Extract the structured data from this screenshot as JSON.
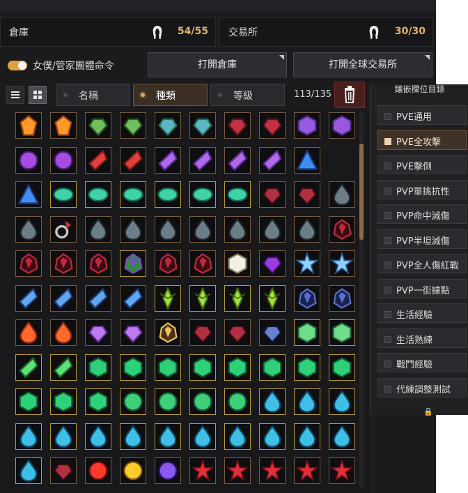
{
  "storage": {
    "label": "倉庫",
    "count": "54/55"
  },
  "market": {
    "label": "交易所",
    "count": "30/30"
  },
  "toggle": {
    "label": "女僕/管家團體命令",
    "on": true
  },
  "buttons": {
    "open_storage": "打開倉庫",
    "open_global_market": "打開全球交易所"
  },
  "filters": {
    "name": "名稱",
    "type": "種類",
    "grade": "等級",
    "active": "type"
  },
  "inventory_count": "113/135",
  "sidebar": {
    "title": "鑲嵌欄位目錄",
    "items": [
      {
        "label": "PVE通用",
        "active": false
      },
      {
        "label": "PVE全攻擊",
        "active": true
      },
      {
        "label": "PVE擊倒",
        "active": false
      },
      {
        "label": "PVP單挑抗性",
        "active": false
      },
      {
        "label": "PVP命中減傷",
        "active": false
      },
      {
        "label": "PVP半坦減傷",
        "active": false
      },
      {
        "label": "PVP全人傷紅戰",
        "active": false
      },
      {
        "label": "PVP一街據點",
        "active": false
      },
      {
        "label": "生活經驗",
        "active": false
      },
      {
        "label": "生活熟練",
        "active": false
      },
      {
        "label": "戰鬥經驗",
        "active": false
      },
      {
        "label": "代練調整測試",
        "active": false
      }
    ]
  },
  "grid_rows": [
    [
      "orange-crystal",
      "orange-crystal",
      "green-gem",
      "green-gem",
      "blue-green-gem",
      "blue-green-gem",
      "red-gem",
      "red-gem",
      "purple-hexagon",
      "purple-hexagon"
    ],
    [
      "purple-orb",
      "purple-orb",
      "red-shard",
      "red-shard",
      "purple-shard",
      "purple-shard",
      "purple-shard",
      "purple-shard",
      "blue-triangle"
    ],
    [
      "blue-triangle",
      "teal-oval",
      "teal-oval",
      "teal-oval",
      "teal-oval",
      "teal-oval",
      "teal-oval",
      "dark-red-gem",
      "dark-red-gem",
      "dark-crystal"
    ],
    [
      "dark-crystal",
      "ring-stone",
      "dark-crystal",
      "dark-crystal",
      "dark-crystal",
      "dark-crystal",
      "dark-crystal",
      "dark-crystal",
      "dark-crystal",
      "dark-red-cluster"
    ],
    [
      "dark-red-cluster",
      "dark-red-cluster",
      "dark-red-cluster",
      "purple-green-cluster",
      "dark-red-cluster",
      "dark-red-cluster",
      "white-gem",
      "purple-gem",
      "blue-star",
      "blue-star"
    ],
    [
      "blue-shard",
      "blue-shard",
      "blue-shard",
      "blue-shard",
      "green-spike",
      "green-spike",
      "green-spike",
      "green-spike",
      "dark-blue-gem",
      "dark-blue-gem"
    ],
    [
      "orange-drop",
      "orange-drop",
      "violet-gem",
      "violet-gem",
      "amber-gem",
      "dark-red-gem",
      "dark-red-gem",
      "navy-gem",
      "green-hexagon",
      "green-hexagon"
    ],
    [
      "green-shard",
      "green-shard",
      "emerald",
      "emerald",
      "emerald",
      "emerald",
      "emerald",
      "emerald",
      "emerald",
      "emerald"
    ],
    [
      "emerald",
      "emerald",
      "emerald",
      "green-round",
      "green-round",
      "green-round",
      "green-round",
      "cyan-drop",
      "cyan-drop",
      "cyan-drop"
    ],
    [
      "cyan-drop",
      "cyan-drop",
      "cyan-drop",
      "cyan-drop",
      "cyan-drop",
      "cyan-drop",
      "cyan-drop",
      "cyan-drop",
      "cyan-drop",
      "cyan-drop"
    ],
    [
      "cyan-drop",
      "dark-red-gem",
      "red-orb",
      "gold-orb",
      "violet-orb",
      "red-star",
      "red-star",
      "red-star",
      "red-star",
      "red-star"
    ]
  ],
  "colors": {
    "accent": "#e0b36a",
    "frame": "#735b42",
    "frame_gold": "#b7993a"
  }
}
